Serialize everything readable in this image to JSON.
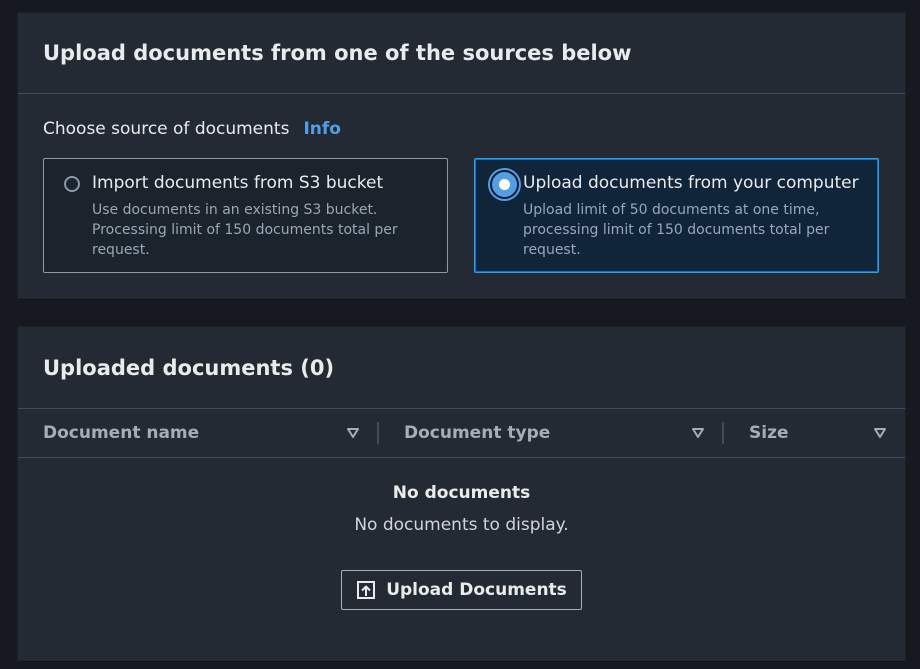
{
  "source_panel": {
    "title": "Upload documents from one of the sources below",
    "form_label": "Choose source of documents",
    "info_link": "Info",
    "options": [
      {
        "title": "Import documents from S3 bucket",
        "description": "Use documents in an existing S3 bucket. Processing limit of 150 documents total per request.",
        "selected": false
      },
      {
        "title": "Upload documents from your computer",
        "description": "Upload limit of 50 documents at one time, processing limit of 150 documents total per request.",
        "selected": true
      }
    ]
  },
  "docs_panel": {
    "title": "Uploaded documents (0)",
    "columns": [
      "Document name",
      "Document type",
      "Size"
    ],
    "empty_title": "No documents",
    "empty_text": "No documents to display.",
    "upload_button": "Upload Documents"
  },
  "icons": {
    "sort": "sort-down-icon",
    "upload": "upload-icon"
  },
  "colors": {
    "accent": "#539fe5",
    "panel_bg": "#232a33",
    "page_bg": "#16191f"
  }
}
